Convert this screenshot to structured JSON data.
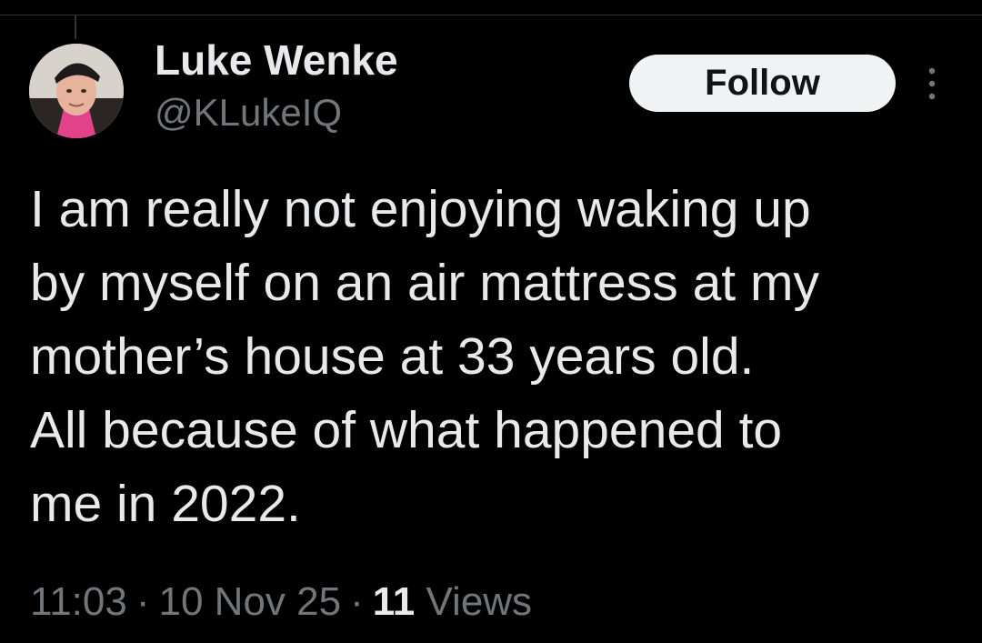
{
  "tweet": {
    "author": {
      "display_name": "Luke Wenke",
      "handle": "@KLukeIQ",
      "avatar_icon": "avatar-photo"
    },
    "follow_label": "Follow",
    "more_icon": "more-vertical-icon",
    "text": "I am really not enjoying waking up\nby myself on an air mattress at my\nmother’s house at 33 years old.\nAll because of what happened to\nme in 2022.",
    "time": "11:03",
    "date": "10 Nov 25",
    "separator": "·",
    "views_count": "11",
    "views_label": "Views"
  },
  "colors": {
    "background": "#000000",
    "text_primary": "#e7e9ea",
    "text_secondary": "#71767b",
    "button_bg": "#eff3f4",
    "button_text": "#0f1419"
  }
}
